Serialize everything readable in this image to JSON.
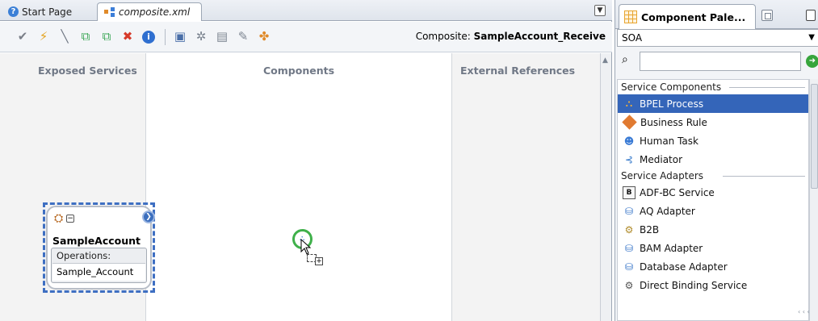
{
  "editor": {
    "tabs": [
      {
        "label": "Start Page",
        "icon": "help-icon"
      },
      {
        "label": "composite.xml",
        "icon": "composite-icon"
      }
    ],
    "toolbar": {
      "buttons": [
        "validate-check",
        "lightning",
        "connector",
        "create-component",
        "group",
        "delete",
        "info",
        "deploy",
        "wizard",
        "reload",
        "properties",
        "publish"
      ],
      "composite_prefix": "Composite:",
      "composite_name": "SampleAccount_Receive"
    },
    "lanes": {
      "services": "Exposed Services",
      "components": "Components",
      "references": "External References"
    },
    "service_component": {
      "name": "SampleAccount",
      "operations_label": "Operations:",
      "operation": "Sample_Account"
    }
  },
  "palette": {
    "tab_title": "Component Pale...",
    "category": "SOA",
    "search_placeholder": "",
    "sections": [
      {
        "title": "Service Components",
        "items": [
          {
            "label": "BPEL Process",
            "icon": "bpel-icon",
            "selected": true
          },
          {
            "label": "Business Rule",
            "icon": "rule-icon"
          },
          {
            "label": "Human Task",
            "icon": "task-icon"
          },
          {
            "label": "Mediator",
            "icon": "mediator-icon"
          }
        ]
      },
      {
        "title": "Service Adapters",
        "items": [
          {
            "label": "ADF-BC Service",
            "icon": "adf-icon"
          },
          {
            "label": "AQ Adapter",
            "icon": "adapter-icon"
          },
          {
            "label": "B2B",
            "icon": "b2b-icon"
          },
          {
            "label": "BAM Adapter",
            "icon": "adapter-icon"
          },
          {
            "label": "Database Adapter",
            "icon": "adapter-icon"
          },
          {
            "label": "Direct Binding Service",
            "icon": "gear-icon"
          }
        ]
      }
    ]
  },
  "colors": {
    "selection": "#3465b9",
    "drop_target": "#3fb04a",
    "selection_border": "#3e6fc2"
  }
}
